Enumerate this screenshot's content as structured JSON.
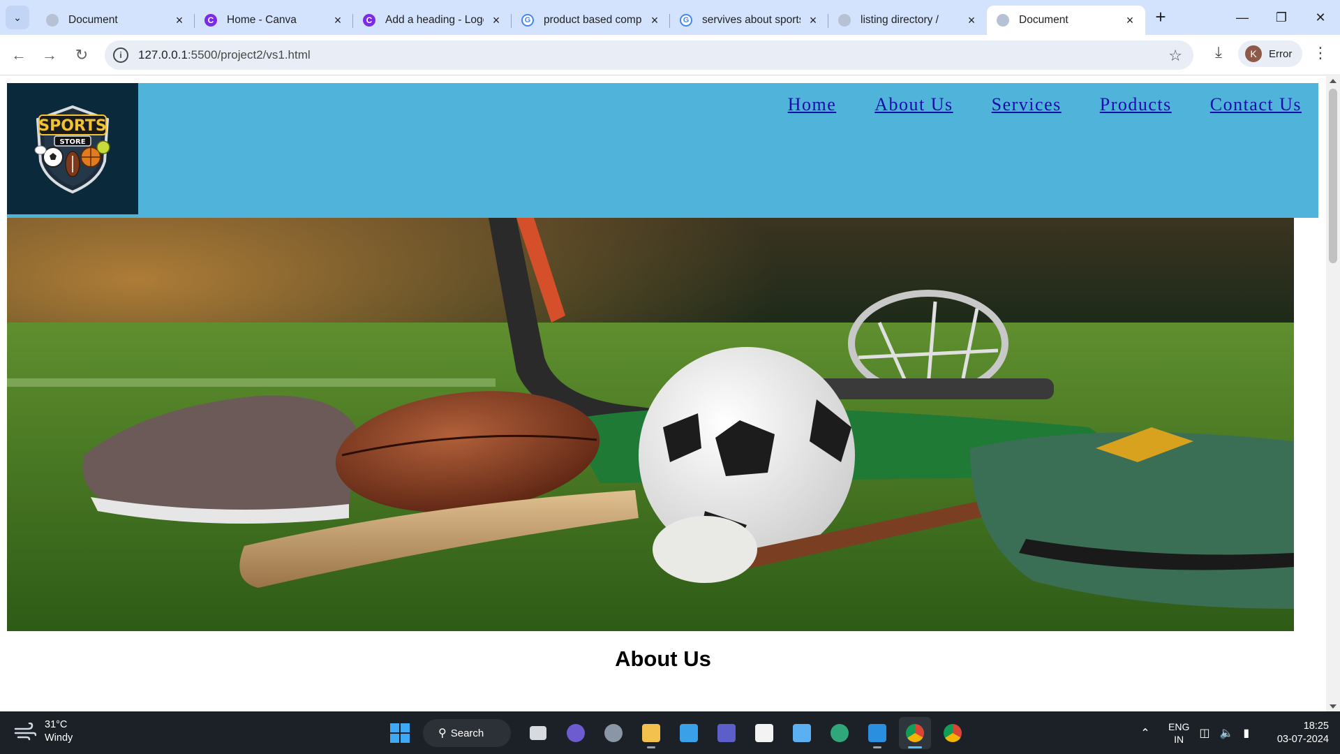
{
  "browser": {
    "tabs": [
      {
        "title": "Document",
        "favicon": "globe-icon",
        "active": false
      },
      {
        "title": "Home - Canva",
        "favicon": "canva-icon",
        "active": false
      },
      {
        "title": "Add a heading - Logo",
        "favicon": "canva-icon",
        "active": false
      },
      {
        "title": "product based comp",
        "favicon": "google-icon",
        "active": false
      },
      {
        "title": "servives about sports",
        "favicon": "google-icon",
        "active": false
      },
      {
        "title": "listing directory /",
        "favicon": "globe-icon",
        "active": false
      },
      {
        "title": "Document",
        "favicon": "globe-icon",
        "active": true
      }
    ],
    "url_host": "127.0.0.1",
    "url_rest": ":5500/project2/vs1.html",
    "profile_initial": "K",
    "profile_status": "Error"
  },
  "site": {
    "logo_top": "SPORTS",
    "logo_bottom": "STORE",
    "nav": [
      "Home",
      "About Us",
      "Services",
      "Products",
      "Contact Us"
    ],
    "header_color": "#4fb3da",
    "logo_bg": "#0a2a3c",
    "about_title": "About Us"
  },
  "taskbar": {
    "temperature": "31°C",
    "weather": "Windy",
    "search_label": "Search",
    "lang_top": "ENG",
    "lang_bottom": "IN",
    "time": "18:25",
    "date": "03-07-2024"
  }
}
